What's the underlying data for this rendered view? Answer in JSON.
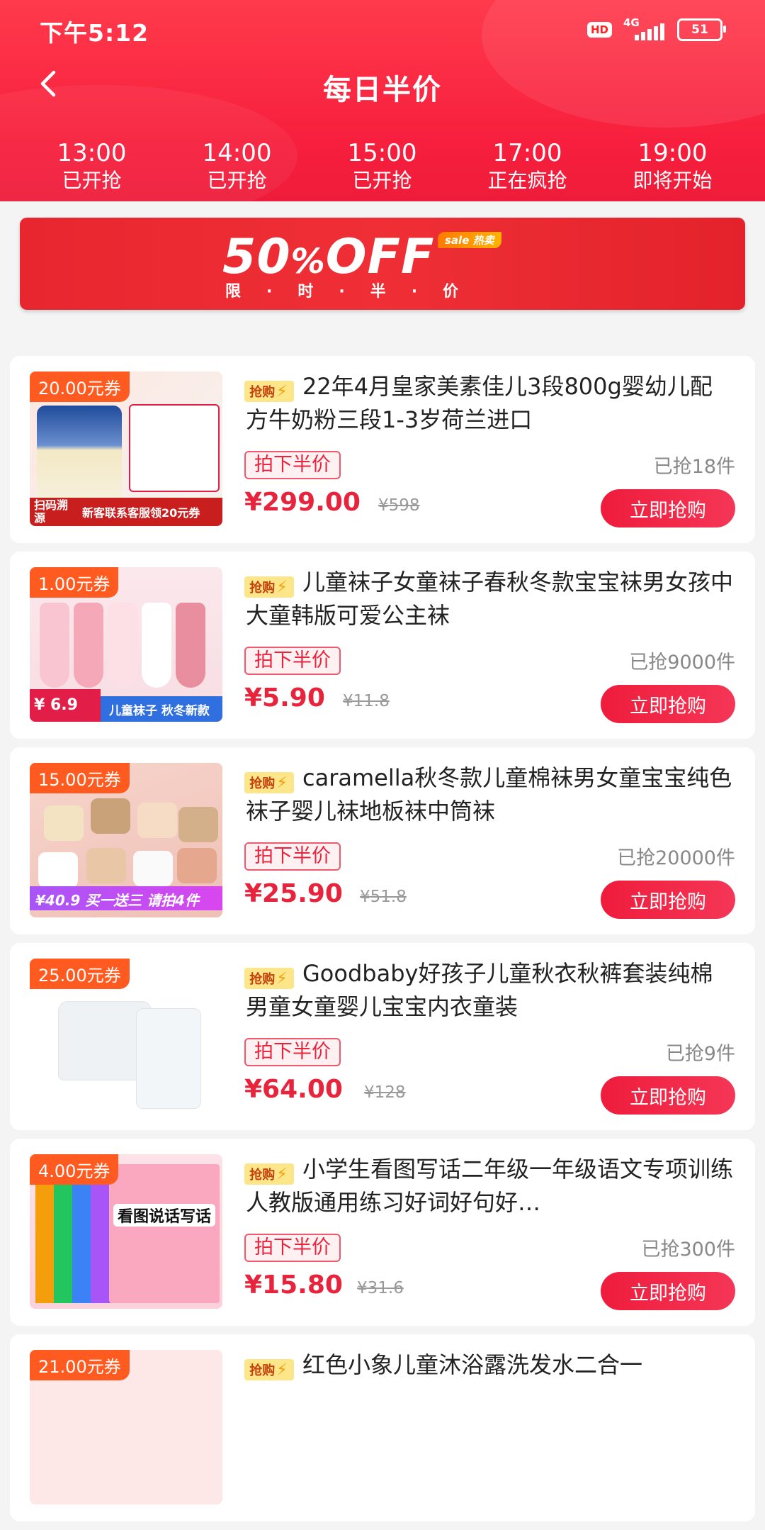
{
  "status": {
    "time": "下午5:12",
    "hd": "HD",
    "network": "4G",
    "battery": "51"
  },
  "nav": {
    "title": "每日半价"
  },
  "slots": [
    {
      "time": "13:00",
      "state": "已开抢"
    },
    {
      "time": "14:00",
      "state": "已开抢"
    },
    {
      "time": "15:00",
      "state": "已开抢"
    },
    {
      "time": "17:00",
      "state": "正在疯抢"
    },
    {
      "time": "19:00",
      "state": "即将开始"
    }
  ],
  "banner": {
    "headline_num": "50",
    "headline_pct": "%",
    "headline_off": "OFF",
    "tag": "sale 热卖",
    "sub": "限·时·半·价"
  },
  "labels": {
    "half_price": "拍下半价",
    "buy": "立即抢购",
    "qiang": "抢购"
  },
  "products": [
    {
      "coupon": "20.00元券",
      "title": "22年4月皇家美素佳儿3段800g婴幼儿配方牛奶粉三段1-3岁荷兰进口",
      "sold": "已抢18件",
      "price": "¥299.00",
      "orig": "¥598"
    },
    {
      "coupon": "1.00元券",
      "title": "儿童袜子女童袜子春秋冬款宝宝袜男女孩中大童韩版可爱公主袜",
      "sold": "已抢9000件",
      "price": "¥5.90",
      "orig": "¥11.8"
    },
    {
      "coupon": "15.00元券",
      "title": "caramella秋冬款儿童棉袜男女童宝宝纯色袜子婴儿袜地板袜中筒袜",
      "sold": "已抢20000件",
      "price": "¥25.90",
      "orig": "¥51.8"
    },
    {
      "coupon": "25.00元券",
      "title": "Goodbaby好孩子儿童秋衣秋裤套装纯棉男童女童婴儿宝宝内衣童装",
      "sold": "已抢9件",
      "price": "¥64.00",
      "orig": "¥128"
    },
    {
      "coupon": "4.00元券",
      "title": "小学生看图写话二年级一年级语文专项训练人教版通用练习好词好句好…",
      "sold": "已抢300件",
      "price": "¥15.80",
      "orig": "¥31.6"
    }
  ],
  "thumb_text": {
    "p1_bottom": "新客联系客服领20元券",
    "p1_left": "扫码溯源",
    "p2_bottom": "儿童袜子 秋冬新款",
    "p2_price": "¥ 6.9",
    "p3_bar": "¥40.9 买一送三 请拍4件",
    "p5_cover": "看图说话写话"
  },
  "partial": {
    "coupon": "21.00元券",
    "title": "红色小象儿童沐浴露洗发水二合一"
  },
  "colors": {
    "accent": "#e8243c",
    "header": "#f71f3d",
    "coupon": "#ff5a1f"
  }
}
